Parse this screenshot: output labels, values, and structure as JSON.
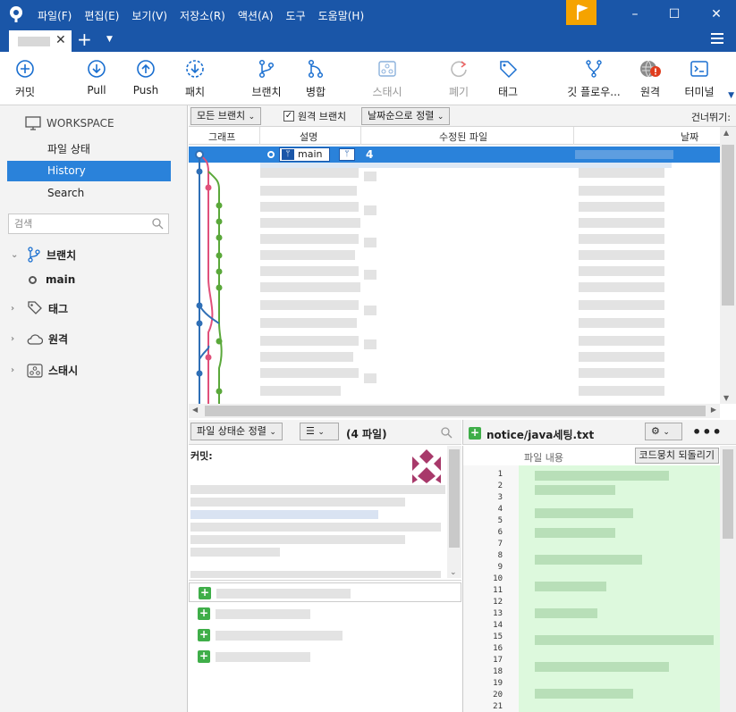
{
  "menu": [
    "파일(F)",
    "편집(E)",
    "보기(V)",
    "저장소(R)",
    "액션(A)",
    "도구",
    "도움말(H)"
  ],
  "toolbar": {
    "commit": "커밋",
    "pull": "Pull",
    "push": "Push",
    "patch": "패치",
    "branch": "브랜치",
    "merge": "병합",
    "stash": "스태시",
    "discard": "폐기",
    "tag": "태그",
    "gitflow": "깃 플로우...",
    "remote": "원격",
    "terminal": "터미널"
  },
  "sidebar": {
    "workspace": "WORKSPACE",
    "items": [
      {
        "label": "파일 상태"
      },
      {
        "label": "History"
      },
      {
        "label": "Search"
      }
    ],
    "search_placeholder": "검색",
    "branches": "브랜치",
    "branch_main": "main",
    "tags": "태그",
    "remotes": "원격",
    "stashes": "스태시"
  },
  "filterbar": {
    "all_branches": "모든 브랜치",
    "remote_branches": "원격 브랜치",
    "sort": "날짜순으로 정렬",
    "skip": "건너뛰기:"
  },
  "columns": {
    "graph": "그래프",
    "desc": "설명",
    "modified": "수정된 파일",
    "date": "날짜"
  },
  "selected_row": {
    "branch": "main",
    "count": "4"
  },
  "bottom_left": {
    "sort": "파일 상태순 정렬",
    "count": "(4 파일)",
    "commit_label": "커밋:"
  },
  "bottom_right": {
    "filename": "notice/java세팅.txt",
    "file_content": "파일 내용",
    "revert": "코드뭉치 되돌리기"
  },
  "lines": [
    "1",
    "2",
    "3",
    "4",
    "5",
    "6",
    "7",
    "8",
    "9",
    "10",
    "11",
    "12",
    "13",
    "14",
    "15",
    "16",
    "17",
    "18",
    "19",
    "20",
    "21"
  ],
  "colors": {
    "accent": "#2a82da",
    "titlebar": "#1a56a8",
    "green": "#3fae49"
  }
}
